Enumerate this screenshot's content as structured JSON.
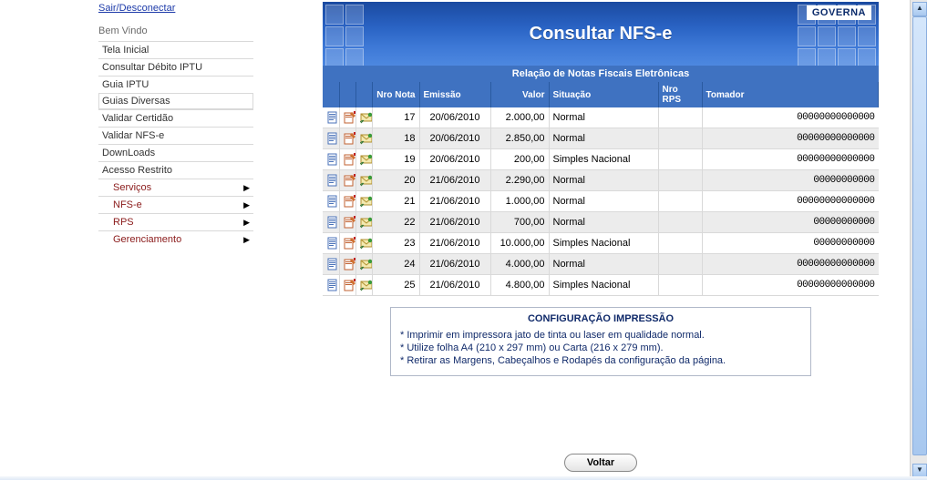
{
  "sidebar": {
    "disconnect": "Sair/Desconectar",
    "welcome": "Bem Vindo",
    "items": [
      {
        "label": "Tela Inicial"
      },
      {
        "label": "Consultar Débito IPTU"
      },
      {
        "label": "Guia IPTU"
      },
      {
        "label": "Guias Diversas",
        "selected": true
      },
      {
        "label": "Validar Certidão"
      },
      {
        "label": "Validar NFS-e"
      },
      {
        "label": "DownLoads"
      },
      {
        "label": "Acesso Restrito"
      }
    ],
    "subitems": [
      {
        "label": "Serviços"
      },
      {
        "label": "NFS-e"
      },
      {
        "label": "RPS"
      },
      {
        "label": "Gerenciamento"
      }
    ]
  },
  "header": {
    "title": "Consultar NFS-e",
    "brand": "GOVERNA"
  },
  "table": {
    "subheader": "Relação de Notas Fiscais Eletrônicas",
    "columns": [
      "",
      "",
      "",
      "Nro Nota",
      "Emissão",
      "Valor",
      "Situação",
      "Nro RPS",
      "Tomador"
    ],
    "rows": [
      {
        "nro": "17",
        "date": "20/06/2010",
        "valor": "2.000,00",
        "sit": "Normal",
        "rps": "",
        "tom": "00000000000000"
      },
      {
        "nro": "18",
        "date": "20/06/2010",
        "valor": "2.850,00",
        "sit": "Normal",
        "rps": "",
        "tom": "00000000000000"
      },
      {
        "nro": "19",
        "date": "20/06/2010",
        "valor": "200,00",
        "sit": "Simples Nacional",
        "rps": "",
        "tom": "00000000000000"
      },
      {
        "nro": "20",
        "date": "21/06/2010",
        "valor": "2.290,00",
        "sit": "Normal",
        "rps": "",
        "tom": "00000000000"
      },
      {
        "nro": "21",
        "date": "21/06/2010",
        "valor": "1.000,00",
        "sit": "Normal",
        "rps": "",
        "tom": "00000000000000"
      },
      {
        "nro": "22",
        "date": "21/06/2010",
        "valor": "700,00",
        "sit": "Normal",
        "rps": "",
        "tom": "00000000000"
      },
      {
        "nro": "23",
        "date": "21/06/2010",
        "valor": "10.000,00",
        "sit": "Simples Nacional",
        "rps": "",
        "tom": "00000000000"
      },
      {
        "nro": "24",
        "date": "21/06/2010",
        "valor": "4.000,00",
        "sit": "Normal",
        "rps": "",
        "tom": "00000000000000"
      },
      {
        "nro": "25",
        "date": "21/06/2010",
        "valor": "4.800,00",
        "sit": "Simples Nacional",
        "rps": "",
        "tom": "00000000000000"
      }
    ]
  },
  "config": {
    "title": "CONFIGURAÇÃO IMPRESSÃO",
    "line1": "* Imprimir em impressora jato de tinta ou laser em qualidade normal.",
    "line2": "* Utilize folha A4 (210 x 297 mm) ou Carta (216 x 279 mm).",
    "line3": "* Retirar as Margens, Cabeçalhos e Rodapés da configuração da página."
  },
  "buttons": {
    "back": "Voltar"
  }
}
